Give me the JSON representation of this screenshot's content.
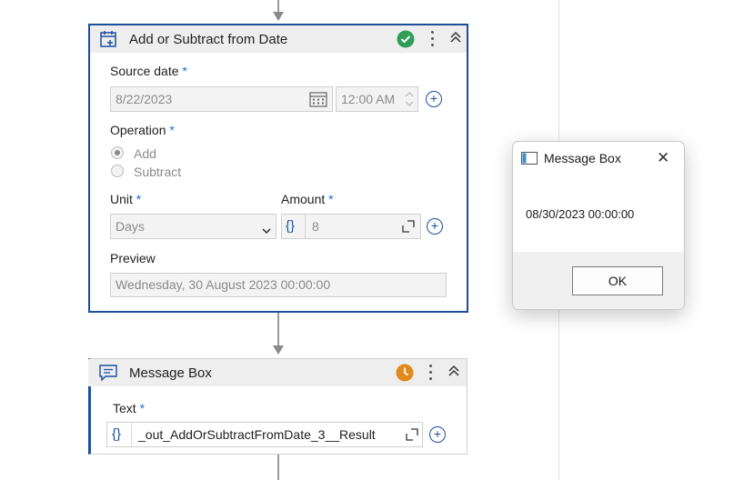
{
  "activity1": {
    "title": "Add or Subtract from Date",
    "status_icon": "check-circle-icon",
    "source_date": {
      "label": "Source date",
      "required_mark": "*",
      "date_value": "8/22/2023",
      "time_value": "12:00 AM"
    },
    "operation": {
      "label": "Operation",
      "required_mark": "*",
      "options": [
        "Add",
        "Subtract"
      ],
      "selected": "Add"
    },
    "unit": {
      "label": "Unit",
      "required_mark": "*",
      "value": "Days"
    },
    "amount": {
      "label": "Amount",
      "required_mark": "*",
      "expr_icon": "{}",
      "value": "8"
    },
    "preview": {
      "label": "Preview",
      "value": "Wednesday, 30 August 2023 00:00:00"
    }
  },
  "activity2": {
    "title": "Message Box",
    "status_icon": "clock-icon",
    "text": {
      "label": "Text",
      "required_mark": "*",
      "expr_icon": "{}",
      "value": "_out_AddOrSubtractFromDate_3__Result"
    }
  },
  "dialog": {
    "title": "Message Box",
    "close_label": "✕",
    "message": "08/30/2023 00:00:00",
    "ok_label": "OK"
  },
  "colors": {
    "accent": "#1a4fa0",
    "required": "#1a6fd6",
    "success": "#2e9e57",
    "pending": "#e08a1e"
  }
}
